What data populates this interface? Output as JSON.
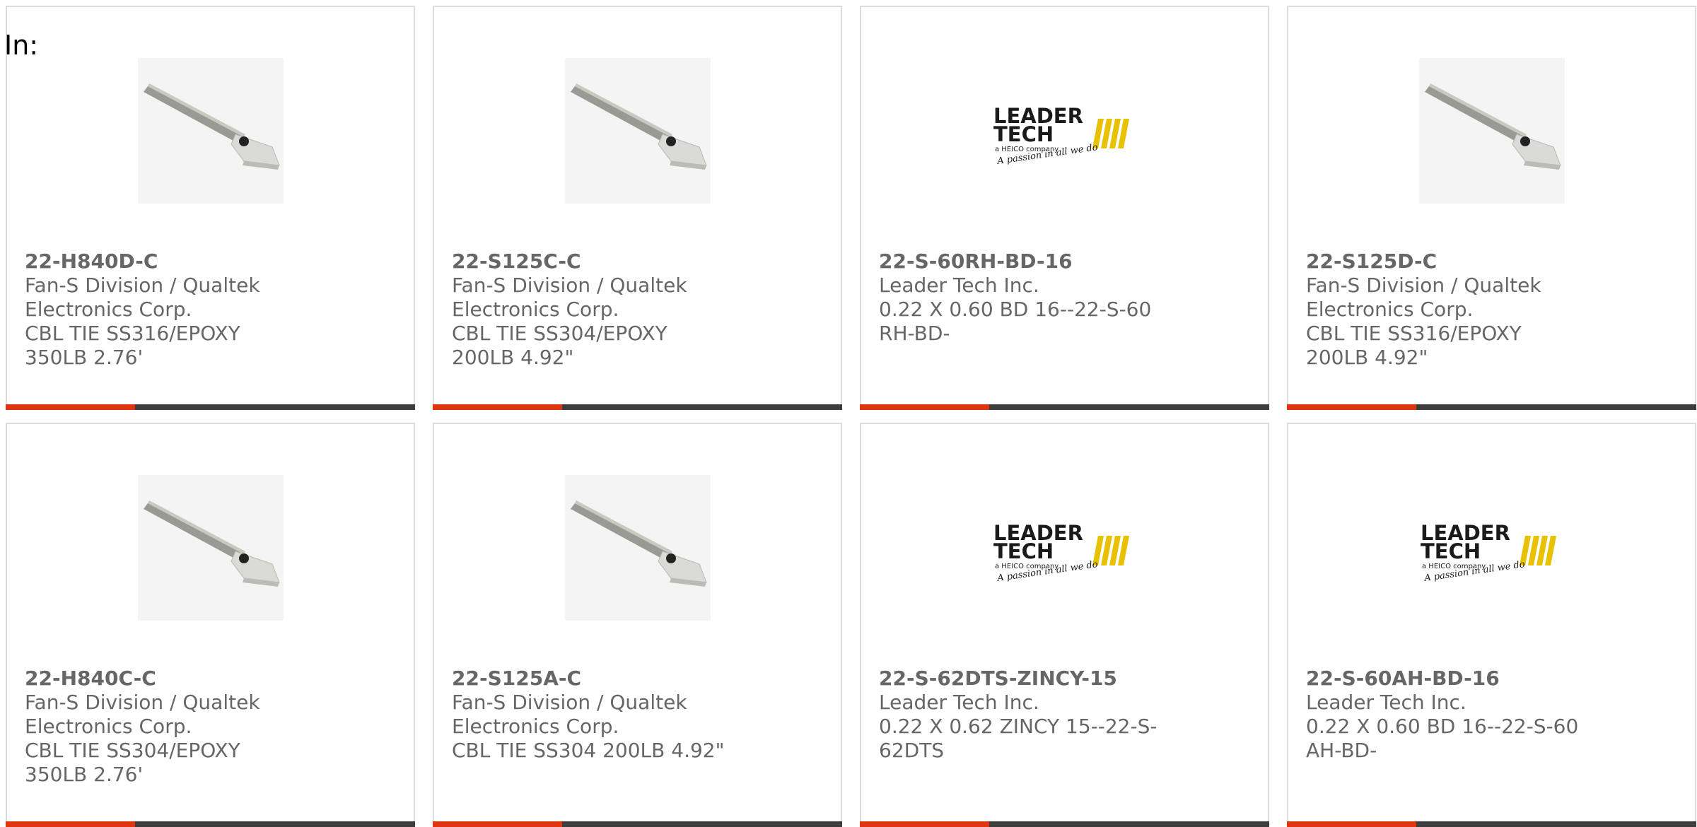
{
  "filter_label": "In:",
  "colors": {
    "accent": "#e0360f",
    "bar": "#3d3d3d",
    "text": "#666666",
    "border": "#dcdcdc"
  },
  "products": [
    {
      "part_number": "22-H840D-C",
      "manufacturer": "Fan-S Division / Qualtek Electronics Corp.",
      "description": "CBL TIE SS316/EPOXY 350LB 2.76'",
      "image": "cable-tie-image"
    },
    {
      "part_number": "22-S125C-C",
      "manufacturer": "Fan-S Division / Qualtek Electronics Corp.",
      "description": "CBL TIE SS304/EPOXY 200LB 4.92\"",
      "image": "cable-tie-image"
    },
    {
      "part_number": "22-S-60RH-BD-16",
      "manufacturer": "Leader Tech Inc.",
      "description": "0.22 X 0.60 BD 16--22-S-60RH-BD-",
      "image": "leader-tech-logo",
      "logo_text": {
        "line1": "LEADER",
        "line2": "TECH",
        "line3": "a HEICO company",
        "line4": "A passion in all we do"
      }
    },
    {
      "part_number": "22-S125D-C",
      "manufacturer": "Fan-S Division / Qualtek Electronics Corp.",
      "description": "CBL TIE SS316/EPOXY 200LB 4.92\"",
      "image": "cable-tie-image"
    },
    {
      "part_number": "22-H840C-C",
      "manufacturer": "Fan-S Division / Qualtek Electronics Corp.",
      "description": "CBL TIE SS304/EPOXY 350LB 2.76'",
      "image": "cable-tie-image"
    },
    {
      "part_number": "22-S125A-C",
      "manufacturer": "Fan-S Division / Qualtek Electronics Corp.",
      "description": "CBL TIE SS304 200LB 4.92\"",
      "image": "cable-tie-image"
    },
    {
      "part_number": "22-S-62DTS-ZINCY-15",
      "manufacturer": "Leader Tech Inc.",
      "description": "0.22 X 0.62 ZINCY 15--22-S-62DTS",
      "image": "leader-tech-logo",
      "logo_text": {
        "line1": "LEADER",
        "line2": "TECH",
        "line3": "a HEICO company",
        "line4": "A passion in all we do"
      }
    },
    {
      "part_number": "22-S-60AH-BD-16",
      "manufacturer": "Leader Tech Inc.",
      "description": "0.22 X 0.60 BD 16--22-S-60AH-BD-",
      "image": "leader-tech-logo",
      "logo_text": {
        "line1": "LEADER",
        "line2": "TECH",
        "line3": "a HEICO company",
        "line4": "A passion in all we do"
      }
    }
  ]
}
